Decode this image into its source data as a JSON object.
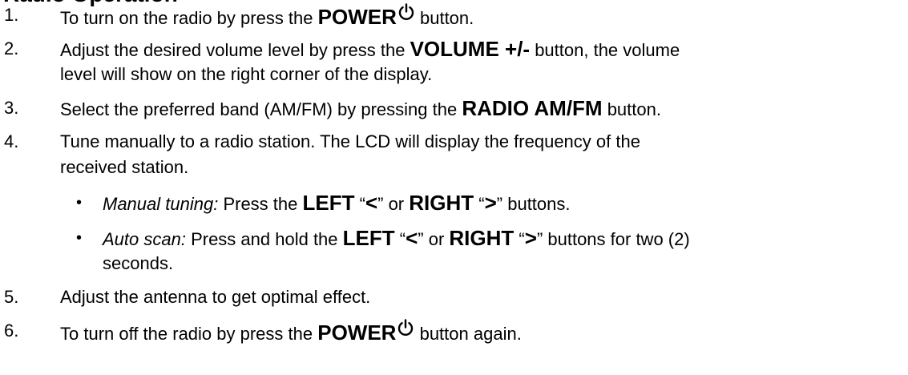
{
  "section": {
    "heading": "Radio Operation"
  },
  "steps": [
    {
      "number": "1.",
      "before": "To turn on the radio by press the ",
      "key": "POWER",
      "icon": "power-icon",
      "after": " button."
    },
    {
      "number": "2.",
      "before": "Adjust the desired volume level by press the ",
      "key": "VOLUME +/-",
      "after": " button, the volume",
      "continuation": "level will show on the right corner of the display."
    },
    {
      "number": "3.",
      "before": "Select the preferred band (AM/FM) by pressing the ",
      "key": "RADIO AM/FM",
      "after": " button."
    },
    {
      "number": "4.",
      "text": "Tune manually to a radio station. The LCD will display the frequency of the",
      "continuation": "received station."
    },
    {
      "number": "5.",
      "text": "Adjust the antenna to get optimal effect."
    },
    {
      "number": "6.",
      "before": "To turn off the radio by press the ",
      "key": "POWER",
      "icon": "power-icon",
      "after": " button again."
    }
  ],
  "sub_steps": [
    {
      "bullet": "•",
      "label": "Manual tuning:",
      "t1": " Press the ",
      "k1": "LEFT",
      "t2": " “",
      "k2": "<",
      "t3": "” or ",
      "k3": "RIGHT",
      "t4": " “",
      "k4": ">",
      "t5": "” buttons."
    },
    {
      "bullet": "•",
      "label": "Auto scan:",
      "t1": " Press and hold the ",
      "k1": "LEFT",
      "t2": " “",
      "k2": "<",
      "t3": "” or ",
      "k3": "RIGHT",
      "t4": " “",
      "k4": ">",
      "t5": "” buttons for two (2)",
      "continuation": "seconds."
    }
  ]
}
